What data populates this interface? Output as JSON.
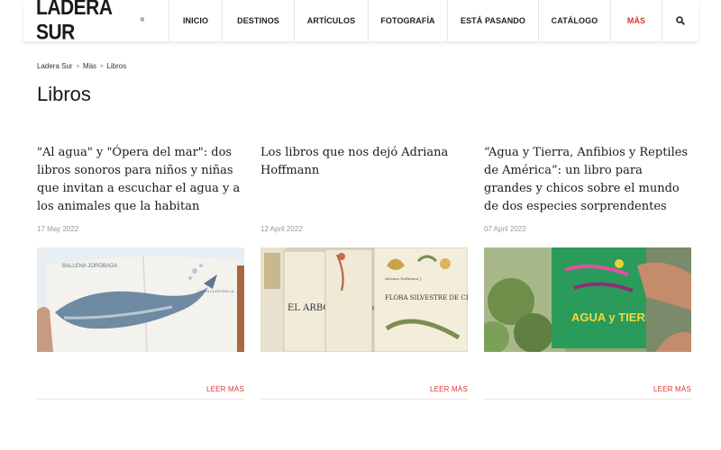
{
  "header": {
    "logo": "LADERA SUR",
    "logo_mark": "®",
    "nav": [
      {
        "label": "INICIO"
      },
      {
        "label": "DESTINOS"
      },
      {
        "label": "ARTÍCULOS"
      },
      {
        "label": "FOTOGRAFÍA"
      },
      {
        "label": "ESTÁ PASANDO"
      },
      {
        "label": "CATÁLOGO"
      },
      {
        "label": "MÁS"
      }
    ],
    "search_icon": "search-icon"
  },
  "breadcrumb": {
    "items": [
      "Ladera Sur",
      "Más",
      "Libros"
    ],
    "separator": "»"
  },
  "page": {
    "title": "Libros"
  },
  "cards": [
    {
      "title": "\"Al agua\" y \"Ópera del mar\": dos libros sonoros para niños y niñas que invitan a escuchar el agua y a los animales que la habitan",
      "date": "17 May 2022",
      "read_more": "LEER MÁS"
    },
    {
      "title": "Los libros que nos dejó Adriana Hoffmann",
      "date": "12 April 2022",
      "read_more": "LEER MÁS"
    },
    {
      "title": "“Agua y Tierra, Anfibios y Reptiles de América”: un libro para grandes y chicos sobre el mundo de dos especies sorprendentes",
      "date": "07 April 2022",
      "read_more": "LEER MÁS"
    }
  ],
  "images": {
    "card1": {
      "label_top": "BALLENA JOROBADA",
      "label_side": "CANTA LA ESTRELLA"
    },
    "card2": {
      "book_a": "EL ARBOL en Chile",
      "book_b": "FLORA SILVESTRE DE CHILE",
      "book_c": "FLORA SILVESTRE DE CHILE zona austral",
      "author": "Adriana Hoffmann J."
    },
    "card3": {
      "cover_title": "AGUA y TIERRA"
    }
  },
  "colors": {
    "accent": "#d6392f",
    "text": "#1a1a1a",
    "muted": "#999999"
  }
}
